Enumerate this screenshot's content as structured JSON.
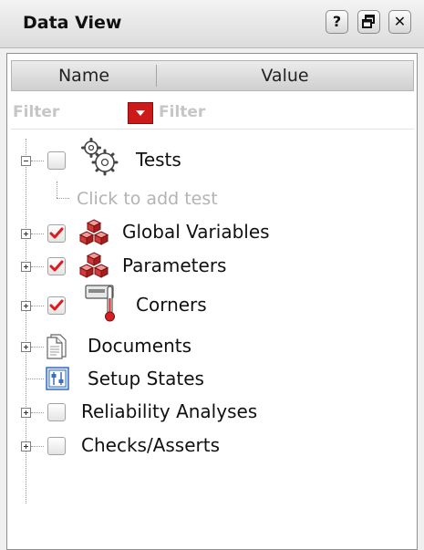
{
  "window": {
    "title": "Data View",
    "buttons": {
      "help": "?",
      "close": "✕"
    }
  },
  "columns": {
    "name": "Name",
    "value": "Value"
  },
  "filters": {
    "name_placeholder": "Filter",
    "value_placeholder": "Filter"
  },
  "tree": {
    "tests": {
      "label": "Tests",
      "checked": false,
      "icon": "gears-icon",
      "expanded": true
    },
    "click_to_add": "Click to add test",
    "global_variables": {
      "label": "Global Variables",
      "checked": true,
      "icon": "red-cubes-icon"
    },
    "parameters": {
      "label": "Parameters",
      "checked": true,
      "icon": "red-cubes-icon"
    },
    "corners": {
      "label": "Corners",
      "checked": true,
      "icon": "thermometer-icon"
    },
    "documents": {
      "label": "Documents",
      "icon": "document-icon"
    },
    "setup_states": {
      "label": "Setup States",
      "icon": "setup-states-icon"
    },
    "reliability_analyses": {
      "label": "Reliability Analyses",
      "checked": false
    },
    "checks_asserts": {
      "label": "Checks/Asserts",
      "checked": false
    }
  },
  "colors": {
    "checkmark": "#e0191c",
    "filter_button": "#cc1a1a",
    "setup_icon": "#3a6fc0"
  }
}
